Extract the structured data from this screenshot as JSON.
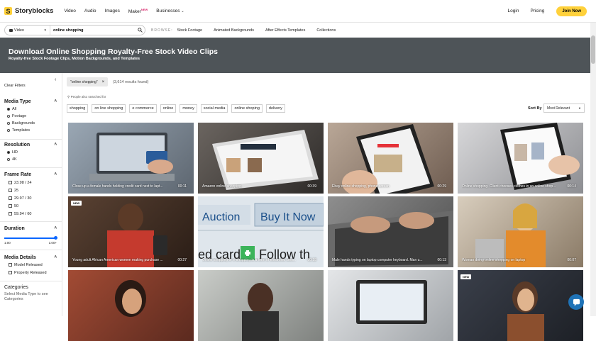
{
  "nav": {
    "logo": "Storyblocks",
    "items": [
      "Video",
      "Audio",
      "Images",
      "Maker",
      "Businesses"
    ],
    "maker_badge": "NEW",
    "login": "Login",
    "pricing": "Pricing",
    "join": "Join Now"
  },
  "search": {
    "media_type": "Video",
    "query": "online shopping",
    "browse_label": "BROWSE:",
    "browse_links": [
      "Stock Footage",
      "Animated Backgrounds",
      "After Effects Templates",
      "Collections"
    ]
  },
  "hero": {
    "title": "Download Online Shopping Royalty-Free Stock Video Clips",
    "subtitle": "Royalty-free Stock Footage Clips, Motion Backgrounds, and Templates"
  },
  "sidebar": {
    "clear_filters": "Clear Filters",
    "media_type": {
      "title": "Media Type",
      "options": [
        "All",
        "Footage",
        "Backgrounds",
        "Templates"
      ],
      "selected": "All"
    },
    "resolution": {
      "title": "Resolution",
      "options": [
        "HD",
        "4K"
      ],
      "selected": "HD"
    },
    "frame_rate": {
      "title": "Frame Rate",
      "options": [
        "23.98 / 24",
        "25",
        "29.97 / 30",
        "50",
        "59.94 / 60"
      ]
    },
    "duration": {
      "title": "Duration",
      "min_label": "1:00",
      "max_label": "1:00+",
      "level": 1.0
    },
    "media_details": {
      "title": "Media Details",
      "options": [
        "Model Released",
        "Property Released"
      ]
    },
    "categories": {
      "title": "Categories",
      "text": "Select Media Type to see Categories"
    }
  },
  "results": {
    "chip": "\"online shopping\"",
    "count": "(3,614 results found)",
    "also_label": "People also searched for",
    "tags": [
      "shopping",
      "on line shopping",
      "e commerce",
      "online",
      "money",
      "social media",
      "online shoping",
      "delivery"
    ],
    "sort_label": "Sort By",
    "sort_value": "Most Relevant",
    "new_badge": "NEW",
    "cards": [
      {
        "caption": "Close up a female hands holding credit card next to lapt...",
        "duration": "00:11"
      },
      {
        "caption": "Amazon online shopping",
        "duration": "00:39"
      },
      {
        "caption": "Ebay online shopping, phone screen",
        "duration": "00:29"
      },
      {
        "caption": "Online shopping. Client chooses clothes in an online shop...",
        "duration": "00:14"
      },
      {
        "caption": "Young adult African American women making purchase ...",
        "duration": "00:27"
      },
      {
        "caption": "Online shopping or e-shopping is a form of electronic com...",
        "duration": "00:18"
      },
      {
        "caption": "Male hands typing on laptop computer keyboard. Man u...",
        "duration": "00:13"
      },
      {
        "caption": "Woman doing online shopping on laptop",
        "duration": "00:07"
      },
      {
        "caption": "",
        "duration": ""
      },
      {
        "caption": "",
        "duration": ""
      },
      {
        "caption": "",
        "duration": ""
      },
      {
        "caption": "",
        "duration": ""
      }
    ],
    "card2_text": {
      "auction": "Auction",
      "buy": "Buy It Now",
      "card": "ed card",
      "follow": "Follow th"
    }
  },
  "colors": {
    "accent": "#ffd13b",
    "hero_bg": "#4e5458",
    "slider": "#0a66ff",
    "chat": "#1f73b7"
  }
}
